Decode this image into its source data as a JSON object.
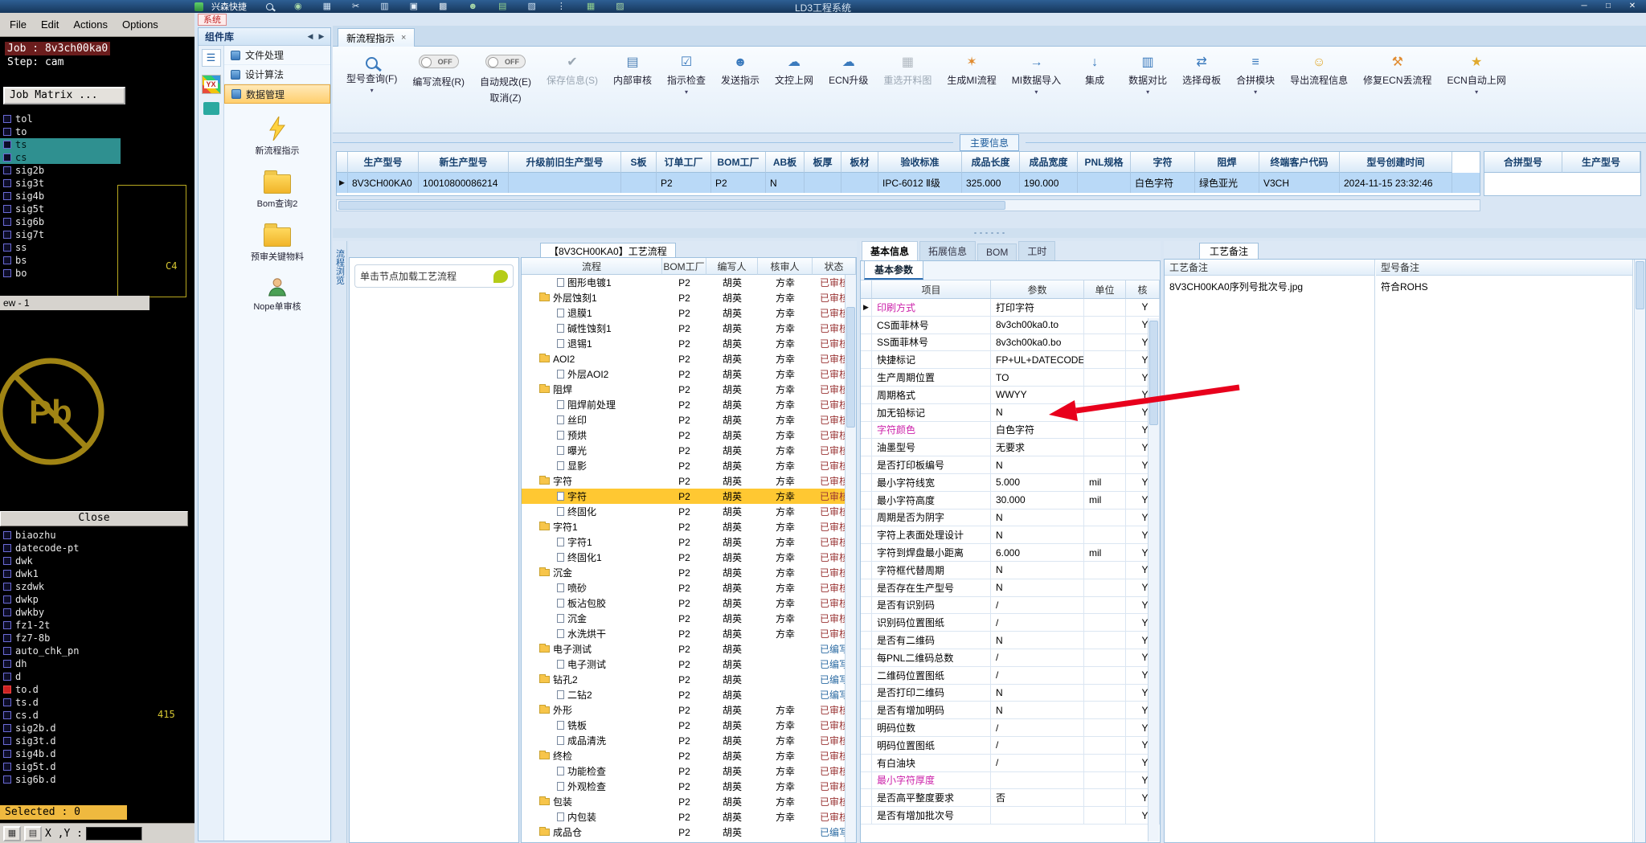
{
  "titlebar": {
    "app_label": "兴森快捷",
    "title": "LD3工程系统",
    "icons": [
      {
        "mag": true,
        "c": "#e6f0fa",
        "n": "search-icon"
      },
      {
        "g": "◉",
        "c": "#a8d8a8",
        "n": "globe-icon"
      },
      {
        "g": "▦",
        "c": "#cfe2f4",
        "n": "table-icon"
      },
      {
        "g": "✂",
        "c": "#e6f0fa",
        "n": "scissors-icon"
      },
      {
        "g": "▥",
        "c": "#cfe2f4",
        "n": "grid-icon"
      },
      {
        "g": "▣",
        "c": "#e6f0fa",
        "n": "copy-icon"
      },
      {
        "g": "▩",
        "c": "#d9e4ee",
        "n": "apps-icon"
      },
      {
        "g": "☻",
        "c": "#a8d8a8",
        "n": "user-icon"
      },
      {
        "g": "▤",
        "c": "#8fcf8f",
        "n": "photo-icon"
      },
      {
        "g": "▧",
        "c": "#cfe2f4",
        "n": "export-icon"
      },
      {
        "g": "⋮",
        "c": "#e6f0fa",
        "n": "menu-icon"
      },
      {
        "g": "▦",
        "c": "#8fcf8f",
        "n": "sheet-icon"
      },
      {
        "g": "▨",
        "c": "#a8d8a8",
        "n": "doc-icon"
      }
    ],
    "window_buttons": [
      {
        "g": "─",
        "n": "minimize-button"
      },
      {
        "g": "□",
        "n": "maximize-button"
      },
      {
        "g": "✕",
        "n": "close-button"
      }
    ]
  },
  "system_tab": "系统",
  "cam": {
    "menu": [
      "File",
      "Edit",
      "Actions",
      "Options"
    ],
    "job": "Job : 8v3ch00ka0",
    "step": "Step: cam",
    "job_matrix": "Job Matrix ...",
    "layers_top": [
      {
        "n": "tol"
      },
      {
        "n": "to"
      },
      {
        "n": "ts",
        "hl": true
      },
      {
        "n": "cs",
        "hl": true
      },
      {
        "n": "sig2b"
      },
      {
        "n": "sig3t"
      },
      {
        "n": "sig4b"
      },
      {
        "n": "sig5t"
      },
      {
        "n": "sig6b"
      },
      {
        "n": "sig7t"
      },
      {
        "n": "ss"
      },
      {
        "n": "bs"
      },
      {
        "n": "bo"
      }
    ],
    "view_label": "ew - 1",
    "c4": "C4",
    "n415": "415",
    "pb": "Pb",
    "close": "Close",
    "layers_bottom": [
      {
        "n": "biaozhu"
      },
      {
        "n": "datecode-pt"
      },
      {
        "n": "dwk"
      },
      {
        "n": "dwk1"
      },
      {
        "n": "szdwk"
      },
      {
        "n": "dwkp"
      },
      {
        "n": "dwkby"
      },
      {
        "n": "fz1-2t"
      },
      {
        "n": "fz7-8b"
      },
      {
        "n": "auto_chk_pn"
      },
      {
        "n": "dh"
      },
      {
        "n": "d"
      },
      {
        "n": "to.d",
        "red": true
      },
      {
        "n": "ts.d"
      },
      {
        "n": "cs.d"
      },
      {
        "n": "sig2b.d"
      },
      {
        "n": "sig3t.d"
      },
      {
        "n": "sig4b.d"
      },
      {
        "n": "sig5t.d"
      },
      {
        "n": "sig6b.d"
      }
    ],
    "selected": "Selected : 0",
    "coords_label": "X ,Y :",
    "grid_buttons": [
      "▦",
      "▤"
    ]
  },
  "sidebar": {
    "title": "组件库",
    "nav_back": "◀",
    "nav_fwd": "▶",
    "logo": "YX",
    "menu": [
      "文件处理",
      "设计算法",
      "数据管理"
    ],
    "tools": [
      "新流程指示",
      "Bom查询2",
      "预审关键物料",
      "Nope单审核"
    ]
  },
  "tabs": {
    "active": "新流程指示",
    "close_glyph": "×"
  },
  "ribbon": {
    "caret": "▾",
    "buttons": [
      {
        "label": "型号查询(F)",
        "mag": true,
        "caret": true
      },
      {
        "toggle": "OFF",
        "label": "编写流程(R)"
      },
      {
        "toggle": "OFF",
        "label": "自动规改(E)",
        "label2": "取消(Z)"
      },
      {
        "label": "保存信息(S)",
        "icon": "✔",
        "c": "#9aa6b2",
        "disabled": true
      },
      {
        "label": "内部审核",
        "icon": "▤",
        "c": "#4a7fb5"
      },
      {
        "label": "指示检查",
        "icon": "☑",
        "c": "#3a7abd",
        "caret": true
      },
      {
        "label": "发送指示",
        "icon": "☻",
        "c": "#3a7abd"
      },
      {
        "label": "文控上网",
        "icon": "☁",
        "c": "#3a7abd"
      },
      {
        "label": "ECN升级",
        "icon": "☁",
        "c": "#3a7abd"
      },
      {
        "label": "重选开料图",
        "icon": "▦",
        "c": "#b0b8c0",
        "disabled": true
      },
      {
        "label": "生成MI流程",
        "icon": "✶",
        "c": "#e08a2e"
      },
      {
        "label": "MI数据导入",
        "icon": "→",
        "c": "#3a7abd",
        "caret": true
      },
      {
        "label": "集成",
        "icon": "↓",
        "c": "#3a7abd"
      },
      {
        "label": "数据对比",
        "icon": "▥",
        "c": "#3a7abd",
        "caret": true
      },
      {
        "label": "选择母板",
        "icon": "⇄",
        "c": "#3a7abd"
      },
      {
        "label": "合拼模块",
        "icon": "≡",
        "c": "#3a7abd",
        "caret": true
      },
      {
        "label": "导出流程信息",
        "icon": "☺",
        "c": "#e0a92e"
      },
      {
        "label": "修复ECN丢流程",
        "icon": "⚒",
        "c": "#e08a2e"
      },
      {
        "label": "ECN自动上网",
        "icon": "★",
        "c": "#e0a92e",
        "caret": true
      }
    ]
  },
  "summary": {
    "section_label": "主要信息",
    "cursor": "▶",
    "columns": [
      "生产型号",
      "新生产型号",
      "升级前旧生产型号",
      "S板",
      "订单工厂",
      "BOM工厂",
      "AB板",
      "板厚",
      "板材",
      "验收标准",
      "成品长度",
      "成品宽度",
      "PNL规格",
      "字符",
      "阻焊",
      "终端客户代码",
      "型号创建时间"
    ],
    "row": [
      "8V3CH00KA0",
      "10010800086214",
      "",
      "",
      "P2",
      "P2",
      "N",
      "",
      "",
      "IPC-6012 Ⅱ级",
      "325.000",
      "190.000",
      "",
      "白色字符",
      "绿色亚光",
      "V3CH",
      "2024-11-15 23:32:46"
    ],
    "right_columns": [
      "合拼型号",
      "生产型号"
    ]
  },
  "process": {
    "side_label": "流程浏览",
    "hint": "单击节点加载工艺流程",
    "title": "【8V3CH00KA0】工艺流程",
    "columns": [
      "流程",
      "BOM工厂",
      "编写人",
      "核审人",
      "状态"
    ],
    "rows": [
      {
        "name": "图形电镀1",
        "fac": "P2",
        "w": "胡英",
        "r": "方幸",
        "st": "已审核"
      },
      {
        "name": "外层蚀刻1",
        "folder": true,
        "fac": "P2",
        "w": "胡英",
        "r": "方幸",
        "st": "已审核"
      },
      {
        "name": "退膜1",
        "fac": "P2",
        "w": "胡英",
        "r": "方幸",
        "st": "已审核"
      },
      {
        "name": "碱性蚀刻1",
        "fac": "P2",
        "w": "胡英",
        "r": "方幸",
        "st": "已审核"
      },
      {
        "name": "退锡1",
        "fac": "P2",
        "w": "胡英",
        "r": "方幸",
        "st": "已审核"
      },
      {
        "name": "AOI2",
        "folder": true,
        "fac": "P2",
        "w": "胡英",
        "r": "方幸",
        "st": "已审核"
      },
      {
        "name": "外层AOI2",
        "fac": "P2",
        "w": "胡英",
        "r": "方幸",
        "st": "已审核"
      },
      {
        "name": "阻焊",
        "folder": true,
        "fac": "P2",
        "w": "胡英",
        "r": "方幸",
        "st": "已审核"
      },
      {
        "name": "阻焊前处理",
        "fac": "P2",
        "w": "胡英",
        "r": "方幸",
        "st": "已审核"
      },
      {
        "name": "丝印",
        "fac": "P2",
        "w": "胡英",
        "r": "方幸",
        "st": "已审核"
      },
      {
        "name": "预烘",
        "fac": "P2",
        "w": "胡英",
        "r": "方幸",
        "st": "已审核"
      },
      {
        "name": "曝光",
        "fac": "P2",
        "w": "胡英",
        "r": "方幸",
        "st": "已审核"
      },
      {
        "name": "显影",
        "fac": "P2",
        "w": "胡英",
        "r": "方幸",
        "st": "已审核"
      },
      {
        "name": "字符",
        "folder": true,
        "fac": "P2",
        "w": "胡英",
        "r": "方幸",
        "st": "已审核"
      },
      {
        "name": "字符",
        "sel": true,
        "fac": "P2",
        "w": "胡英",
        "r": "方幸",
        "st": "已审核"
      },
      {
        "name": "终固化",
        "fac": "P2",
        "w": "胡英",
        "r": "方幸",
        "st": "已审核"
      },
      {
        "name": "字符1",
        "folder": true,
        "fac": "P2",
        "w": "胡英",
        "r": "方幸",
        "st": "已审核"
      },
      {
        "name": "字符1",
        "fac": "P2",
        "w": "胡英",
        "r": "方幸",
        "st": "已审核"
      },
      {
        "name": "终固化1",
        "fac": "P2",
        "w": "胡英",
        "r": "方幸",
        "st": "已审核"
      },
      {
        "name": "沉金",
        "folder": true,
        "fac": "P2",
        "w": "胡英",
        "r": "方幸",
        "st": "已审核"
      },
      {
        "name": "喷砂",
        "fac": "P2",
        "w": "胡英",
        "r": "方幸",
        "st": "已审核"
      },
      {
        "name": "板沾包胶",
        "fac": "P2",
        "w": "胡英",
        "r": "方幸",
        "st": "已审核"
      },
      {
        "name": "沉金",
        "fac": "P2",
        "w": "胡英",
        "r": "方幸",
        "st": "已审核"
      },
      {
        "name": "水洗烘干",
        "fac": "P2",
        "w": "胡英",
        "r": "方幸",
        "st": "已审核"
      },
      {
        "name": "电子测试",
        "folder": true,
        "fac": "P2",
        "w": "胡英",
        "r": "",
        "st": "已编写",
        "pend": true
      },
      {
        "name": "电子测试",
        "fac": "P2",
        "w": "胡英",
        "r": "",
        "st": "已编写",
        "pend": true
      },
      {
        "name": "钻孔2",
        "folder": true,
        "fac": "P2",
        "w": "胡英",
        "r": "",
        "st": "已编写",
        "pend": true
      },
      {
        "name": "二钻2",
        "fac": "P2",
        "w": "胡英",
        "r": "",
        "st": "已编写",
        "pend": true
      },
      {
        "name": "外形",
        "folder": true,
        "fac": "P2",
        "w": "胡英",
        "r": "方幸",
        "st": "已审核"
      },
      {
        "name": "铣板",
        "fac": "P2",
        "w": "胡英",
        "r": "方幸",
        "st": "已审核"
      },
      {
        "name": "成品清洗",
        "fac": "P2",
        "w": "胡英",
        "r": "方幸",
        "st": "已审核"
      },
      {
        "name": "终检",
        "folder": true,
        "fac": "P2",
        "w": "胡英",
        "r": "方幸",
        "st": "已审核"
      },
      {
        "name": "功能检查",
        "fac": "P2",
        "w": "胡英",
        "r": "方幸",
        "st": "已审核"
      },
      {
        "name": "外观检查",
        "fac": "P2",
        "w": "胡英",
        "r": "方幸",
        "st": "已审核"
      },
      {
        "name": "包装",
        "folder": true,
        "fac": "P2",
        "w": "胡英",
        "r": "方幸",
        "st": "已审核"
      },
      {
        "name": "内包装",
        "fac": "P2",
        "w": "胡英",
        "r": "方幸",
        "st": "已审核"
      },
      {
        "name": "成品仓",
        "folder": true,
        "fac": "P2",
        "w": "胡英",
        "r": "",
        "st": "已编写",
        "pend": true
      }
    ]
  },
  "params": {
    "tabs": [
      "基本信息",
      "拓展信息",
      "BOM",
      "工时"
    ],
    "subtab": "基本参数",
    "columns": [
      "项目",
      "参数",
      "单位",
      "核"
    ],
    "rows": [
      {
        "it": "印刷方式",
        "v": "打印字符",
        "fl": "Y",
        "m": true,
        "cur": "▶"
      },
      {
        "it": "CS面菲林号",
        "v": "8v3ch00ka0.to",
        "fl": "Y"
      },
      {
        "it": "SS面菲林号",
        "v": "8v3ch00ka0.bo",
        "fl": "Y"
      },
      {
        "it": "快捷标记",
        "v": "FP+UL+DATECODE",
        "fl": "Y"
      },
      {
        "it": "生产周期位置",
        "v": "TO",
        "fl": "Y"
      },
      {
        "it": "周期格式",
        "v": "WWYY",
        "fl": "Y"
      },
      {
        "it": "加无铅标记",
        "v": "N",
        "fl": "Y"
      },
      {
        "it": "字符颜色",
        "v": "白色字符",
        "fl": "Y",
        "m": true
      },
      {
        "it": "油墨型号",
        "v": "无要求",
        "fl": "Y"
      },
      {
        "it": "是否打印板编号",
        "v": "N",
        "fl": "Y"
      },
      {
        "it": "最小字符线宽",
        "v": "5.000",
        "u": "mil",
        "fl": "Y"
      },
      {
        "it": "最小字符高度",
        "v": "30.000",
        "u": "mil",
        "fl": "Y"
      },
      {
        "it": "周期是否为阴字",
        "v": "N",
        "fl": "Y"
      },
      {
        "it": "字符上表面处理设计",
        "v": "N",
        "fl": "Y"
      },
      {
        "it": "字符到焊盘最小距离",
        "v": "6.000",
        "u": "mil",
        "fl": "Y"
      },
      {
        "it": "字符框代替周期",
        "v": "N",
        "fl": "Y"
      },
      {
        "it": "是否存在生产型号",
        "v": "N",
        "fl": "Y"
      },
      {
        "it": "是否有识别码",
        "v": "/",
        "fl": "Y"
      },
      {
        "it": "识别码位置图纸",
        "v": "/",
        "fl": "Y"
      },
      {
        "it": "是否有二维码",
        "v": "N",
        "fl": "Y"
      },
      {
        "it": "每PNL二维码总数",
        "v": "/",
        "fl": "Y"
      },
      {
        "it": "二维码位置图纸",
        "v": "/",
        "fl": "Y"
      },
      {
        "it": "是否打印二维码",
        "v": "N",
        "fl": "Y"
      },
      {
        "it": "是否有增加明码",
        "v": "N",
        "fl": "Y"
      },
      {
        "it": "明码位数",
        "v": "/",
        "fl": "Y"
      },
      {
        "it": "明码位置图纸",
        "v": "/",
        "fl": "Y"
      },
      {
        "it": "有白油块",
        "v": "/",
        "fl": "Y"
      },
      {
        "it": "最小字符厚度",
        "v": "",
        "fl": "Y",
        "m": true
      },
      {
        "it": "是否高平整度要求",
        "v": "否",
        "fl": "Y"
      },
      {
        "it": "是否有增加批次号",
        "v": "",
        "fl": "Y"
      }
    ]
  },
  "notes": {
    "tab": "工艺备注",
    "col1": "工艺备注",
    "col2": "型号备注",
    "val1": "8V3CH00KA0序列号批次号.jpg",
    "val2": "符合ROHS"
  },
  "colors": {
    "accent_blue": "#2b6cb0",
    "panel_blue": "#dce8f5",
    "selection_orange": "#ffc832",
    "row_selection_blue": "#b9d9f7",
    "status_reviewed": "#993333",
    "status_pending": "#2e6da4",
    "magenta_item": "#cc22aa",
    "arrow_red": "#e8001c",
    "pb_gold": "#a08414",
    "teal_layer_highlight": "#2f9090",
    "selected_bar_yellow": "#efb93f"
  }
}
